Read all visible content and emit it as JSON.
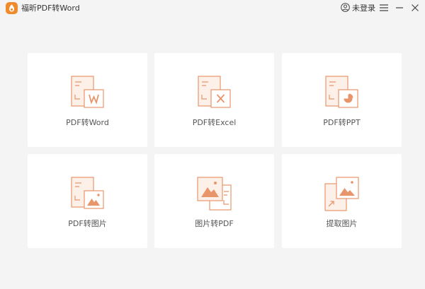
{
  "app": {
    "title": "福昕PDF转Word",
    "accent_color": "#f08a2a",
    "icon": "foxit-logo-icon"
  },
  "header": {
    "login_label": "未登录",
    "login_icon": "user-circle-icon",
    "menu_icon": "hamburger-menu-icon",
    "minimize_icon": "minimize-icon",
    "close_icon": "close-icon"
  },
  "cards": [
    {
      "label": "PDF转Word",
      "icon": "pdf-to-word-icon"
    },
    {
      "label": "PDF转Excel",
      "icon": "pdf-to-excel-icon"
    },
    {
      "label": "PDF转PPT",
      "icon": "pdf-to-ppt-icon"
    },
    {
      "label": "PDF转图片",
      "icon": "pdf-to-image-icon"
    },
    {
      "label": "图片转PDF",
      "icon": "image-to-pdf-icon"
    },
    {
      "label": "提取图片",
      "icon": "extract-image-icon"
    }
  ],
  "icon_colors": {
    "line": "#e8956b",
    "fill": "#fdf0e8",
    "solid": "#e8956b"
  }
}
